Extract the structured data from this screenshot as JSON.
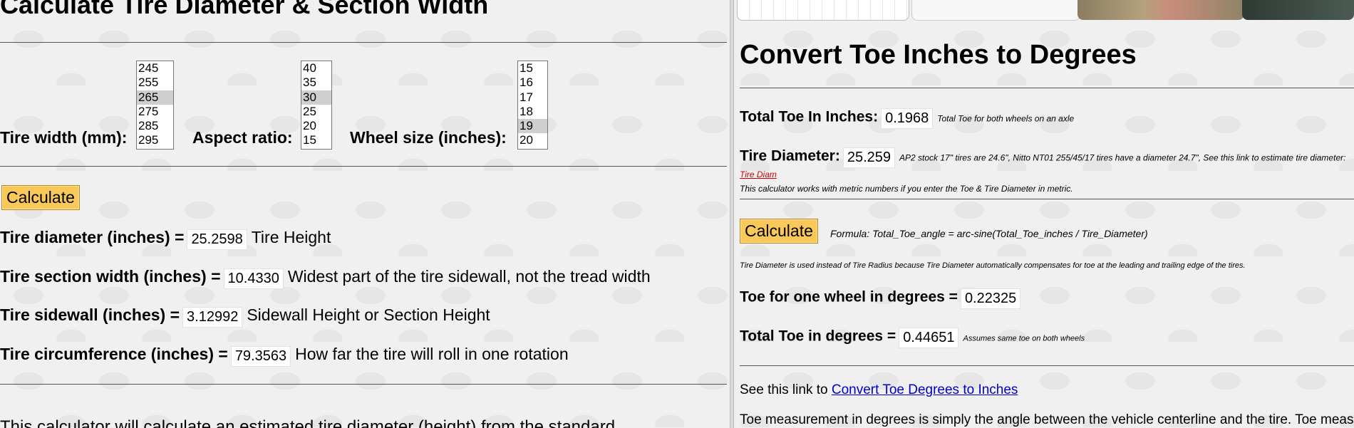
{
  "left": {
    "title": "Calculate Tire Diameter & Section Width",
    "width_label": "Tire width (mm):",
    "width_options": [
      "245",
      "255",
      "265",
      "275",
      "285",
      "295"
    ],
    "width_selected": "265",
    "aspect_label": "Aspect ratio:",
    "aspect_options": [
      "40",
      "35",
      "30",
      "25",
      "20",
      "15"
    ],
    "aspect_selected": "30",
    "wheel_label": "Wheel size (inches):",
    "wheel_options": [
      "15",
      "16",
      "17",
      "18",
      "19",
      "20"
    ],
    "wheel_selected": "19",
    "calculate_label": "Calculate",
    "diameter_label": "Tire diameter (inches) =",
    "diameter_value": "25.2598",
    "diameter_note": "Tire Height",
    "section_label": "Tire section width (inches) =",
    "section_value": "10.4330",
    "section_note": "Widest part of the tire sidewall, not the tread width",
    "sidewall_label": "Tire sidewall (inches) =",
    "sidewall_value": "3.12992",
    "sidewall_note": "Sidewall Height or Section Height",
    "circ_label": "Tire circumference (inches) =",
    "circ_value": "79.3563",
    "circ_note": "How far the tire will roll in one rotation",
    "description": "This calculator will calculate an estimated tire diameter (height) from the standard"
  },
  "right": {
    "title": "Convert Toe Inches to Degrees",
    "toe_in_label": "Total Toe In Inches:",
    "toe_in_value": "0.1968",
    "toe_in_note": "Total Toe for both wheels on an axle",
    "tire_diam_label": "Tire Diameter:",
    "tire_diam_value": "25.259",
    "tire_diam_note": "AP2 stock 17\" tires are 24.6\", Nitto NT01 255/45/17 tires have a diameter 24.7\", See this link to estimate tire diameter:",
    "tire_diam_link": "Tire Diam",
    "metric_note": "This calculator works with metric numbers if you enter the Toe & Tire Diameter in metric.",
    "calculate_label": "Calculate",
    "formula": "Formula: Total_Toe_angle = arc-sine(Total_Toe_inches / Tire_Diameter)",
    "radius_note": "Tire Diameter is used instead of Tire Radius because Tire Diameter automatically compensates for toe at the leading and trailing edge of the tires.",
    "one_wheel_label": "Toe for one wheel in degrees =",
    "one_wheel_value": "0.22325",
    "total_label": "Total Toe in degrees =",
    "total_value": "0.44651",
    "total_note": "Assumes same toe on both wheels",
    "see_link_prefix": "See this link to",
    "see_link_text": "Convert Toe Degrees to Inches",
    "measurement_text": "Toe measurement in degrees is simply the angle between the vehicle centerline and the tire. Toe measurem"
  }
}
